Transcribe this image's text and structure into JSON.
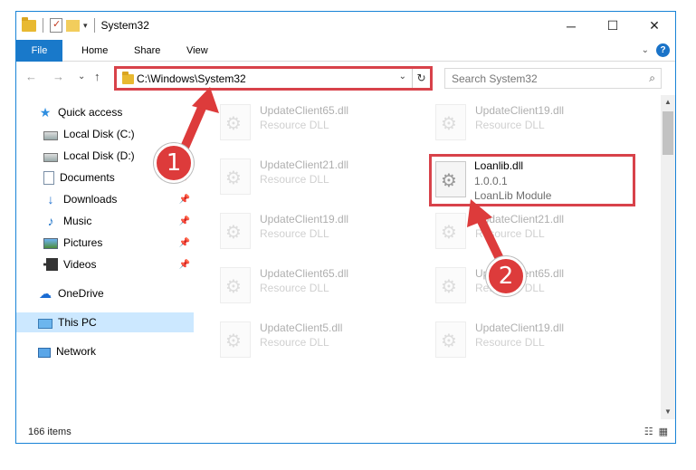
{
  "window": {
    "title": "System32",
    "controls": {
      "minimize": "─",
      "maximize": "☐",
      "close": "✕"
    },
    "qat_customize": "▾"
  },
  "ribbon": {
    "tabs": [
      "File",
      "Home",
      "Share",
      "View"
    ],
    "expand": "⌄",
    "help": "?"
  },
  "nav": {
    "back": "←",
    "forward": "→",
    "recent": "⌄",
    "up": "↑"
  },
  "address": {
    "path": "C:\\Windows\\System32",
    "dropdown": "⌄",
    "refresh": "↻"
  },
  "search": {
    "placeholder": "Search System32",
    "icon": "⌕"
  },
  "navpane": {
    "items": [
      {
        "label": "Quick access",
        "icon": "star-icon",
        "pinned": false
      },
      {
        "label": "Local Disk (C:)",
        "icon": "local-disk-icon",
        "pinned": false
      },
      {
        "label": "Local Disk (D:)",
        "icon": "local-disk-icon",
        "pinned": false
      },
      {
        "label": "Documents",
        "icon": "documents-icon",
        "pinned": true
      },
      {
        "label": "Downloads",
        "icon": "downloads-icon",
        "pinned": true
      },
      {
        "label": "Music",
        "icon": "music-icon",
        "pinned": true
      },
      {
        "label": "Pictures",
        "icon": "pictures-icon",
        "pinned": true
      },
      {
        "label": "Videos",
        "icon": "videos-icon",
        "pinned": true
      },
      {
        "label": "OneDrive",
        "icon": "onedrive-icon",
        "pinned": false
      },
      {
        "label": "This PC",
        "icon": "this-pc-icon",
        "pinned": false,
        "selected": true
      },
      {
        "label": "Network",
        "icon": "network-icon",
        "pinned": false
      }
    ],
    "pin_glyph": "📌"
  },
  "files": [
    {
      "name": "UpdateClient65.dll",
      "type": "Resource DLL"
    },
    {
      "name": "UpdateClient19.dll",
      "type": "Resource DLL"
    },
    {
      "name": "UpdateClient21.dll",
      "type": "Resource DLL"
    },
    {
      "name": "Loanlib.dll",
      "version": "1.0.0.1",
      "description": "LoanLib Module",
      "highlighted": true
    },
    {
      "name": "UpdateClient19.dll",
      "type": "Resource DLL"
    },
    {
      "name": "UpdateClient21.dll",
      "type": "Resource DLL"
    },
    {
      "name": "UpdateClient65.dll",
      "type": "Resource DLL"
    },
    {
      "name": "UpdateClient65.dll",
      "type": "Resource DLL"
    },
    {
      "name": "UpdateClient5.dll",
      "type": "Resource DLL"
    },
    {
      "name": "UpdateClient19.dll",
      "type": "Resource DLL"
    }
  ],
  "status": {
    "item_count": "166 items",
    "view_details": "☷",
    "view_tiles": "▦"
  },
  "scroll": {
    "up": "▲",
    "down": "▼"
  },
  "annotations": {
    "step1": "1",
    "step2": "2",
    "color": "#dd3b3b"
  },
  "colors": {
    "accent": "#1979ca",
    "highlight": "#d8424a",
    "selected_bg": "#cce8ff"
  }
}
